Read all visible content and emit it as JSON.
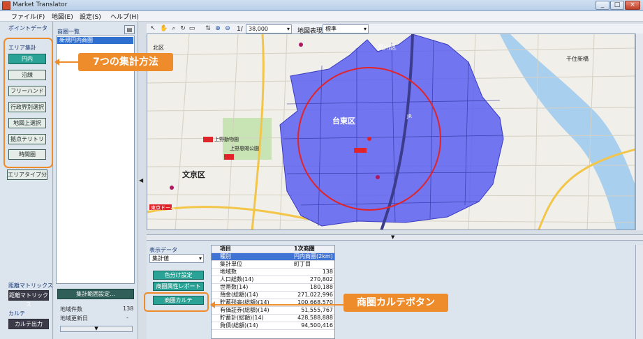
{
  "window": {
    "title": "Market Translator",
    "controls": {
      "minimize": "_",
      "maximize": "□",
      "close": "×"
    }
  },
  "menu": [
    "ファイル(F)",
    "地図(E)",
    "設定(S)",
    "ヘルプ(H)"
  ],
  "left_panel": {
    "point_data_label": "ポイントデータ",
    "area_label": "エリア集計",
    "methods": [
      "円内",
      "沿線",
      "フリーハンド",
      "行政界別選択",
      "地図上選択",
      "拠点テリトリ",
      "時間圏"
    ],
    "area_type_button": "エリアタイプ分析",
    "distance_matrix_label": "距離マトリックス",
    "distance_matrix_button": "距離マトリックス",
    "karte_label": "カルテ",
    "karte_output_button": "カルテ出力"
  },
  "trade_area_panel": {
    "title": "商圏一覧",
    "selected_item": "新規円内商圏",
    "settings_button": "集計範囲設定...",
    "stats": [
      {
        "label": "地域件数",
        "value": "138"
      },
      {
        "label": "地域更新日",
        "value": "-"
      }
    ]
  },
  "map_toolbar": {
    "scale_prefix": "1/",
    "scale_value": "38,000",
    "map_display_label": "地図表現",
    "map_display_value": "標準"
  },
  "map": {
    "labels": [
      "文京区",
      "台東区",
      "上野動物園",
      "上野恩賜公園",
      "荒川区",
      "東京ドーム",
      "JR",
      "千住新橋",
      "北区"
    ],
    "colors": {
      "area_fill": "#5b5ff0",
      "circle": "#e0242a",
      "river": "#a9cfee"
    }
  },
  "bottom_panel": {
    "display_data_label": "表示データ",
    "display_data_value": "集計値",
    "buttons": [
      "色分け設定",
      "商圏属性レポート",
      "商圏カルテ"
    ],
    "table": {
      "headers": [
        "項目",
        "1次商圏"
      ],
      "rows": [
        {
          "item": "種別",
          "value": "円内商圏(2km)",
          "highlight": true
        },
        {
          "item": "集計単位",
          "value": "町丁目"
        },
        {
          "item": "地域数",
          "value": "138"
        },
        {
          "item": "人口総数(14)",
          "value": "270,802"
        },
        {
          "item": "世帯数(14)",
          "value": "180,188"
        },
        {
          "item": "預金(総額)(14)",
          "value": "271,022,996"
        },
        {
          "item": "貯蓄残高(総額)(14)",
          "value": "100,668,570"
        },
        {
          "item": "有価証券(総額)(14)",
          "value": "51,555,767"
        },
        {
          "item": "貯蓄計(総額)(14)",
          "value": "428,588,888"
        },
        {
          "item": "負債(総額)(14)",
          "value": "94,500,416"
        }
      ]
    }
  },
  "callouts": {
    "methods": "7つの集計方法",
    "karte": "商圏カルテボタン"
  }
}
